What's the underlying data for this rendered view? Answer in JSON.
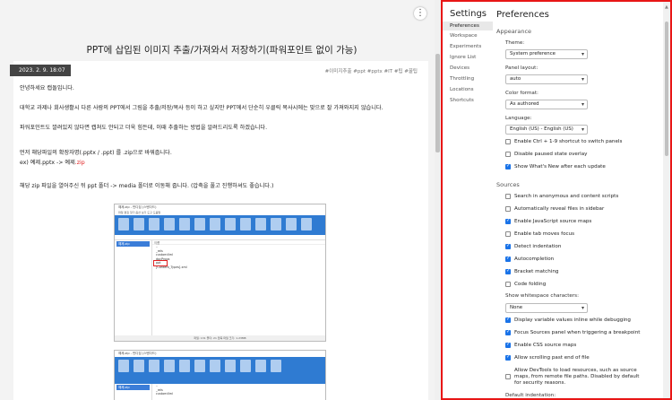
{
  "blog": {
    "menu_icon": "more-vertical-icon",
    "title": "PPT에 삽입된 이미지 추출/가져와서 저장하기(파워포인트 없이 가능)",
    "date": "2023. 2. 9. 18:07",
    "tags": "#이미지추출 #ppt #pptx #IT #팁 #꿀팁",
    "paragraphs": {
      "p1": "안녕하세요 캡돌입니다.",
      "p2": "대학교 과제나 회사생활시 다른 사람의 PPT에서 그림을 추출/저장/복사 등이 하고 싶지만 PPT에서 단순히 우클릭 복사시에는 맞으로 잘 가져와지지 않습니다.",
      "p3": "파워포인트도 깔려있지 않다면 캡쳐도 안되고 더욱 힘든데, 이때 추출하는 방법을 알려드리도록 하겠습니다.",
      "p4": "먼저 해당파일의 확장자명(.pptx / .ppt) 를 .zip으로 바꿔줍니다.",
      "p5_prefix": "ex) 예제.pptx -> 예제",
      "p5_red": ".zip",
      "p6": "해당 zip 파일을 열어주신 뒤 ppt 폴더 -> media 폴더로 이동해 줍니다. (압축을 풀고 진행하셔도 좋습니다.)"
    },
    "screenshot1": {
      "title": "예제.zip - 반디집 (스탠다드)",
      "menu": "파일  편집  찾기  옵션  보기  도구  도움말",
      "tree_item": "예제.zip",
      "header_name": "이름",
      "rows": [
        "..",
        "_rels",
        "customXml",
        "docProps",
        "ppt",
        "[Content_Types].xml"
      ],
      "status": "파일: 131  폴더: 21  압축 파일 크기: 1.23MB"
    },
    "screenshot2": {
      "title": "예제.zip - 반디집 (스탠다드)",
      "tree_item": "예제.zip",
      "rows": [
        "..",
        "_rels",
        "customXml"
      ]
    }
  },
  "devtools": {
    "nav_title": "Settings",
    "nav_items": [
      "Preferences",
      "Workspace",
      "Experiments",
      "Ignore List",
      "Devices",
      "Throttling",
      "Locations",
      "Shortcuts"
    ],
    "page_title": "Preferences",
    "appearance": {
      "heading": "Appearance",
      "theme_label": "Theme:",
      "theme_value": "System preference",
      "panel_layout_label": "Panel layout:",
      "panel_layout_value": "auto",
      "color_format_label": "Color format:",
      "color_format_value": "As authored",
      "language_label": "Language:",
      "language_value": "English (US) - English (US)",
      "checkboxes": [
        {
          "label": "Enable Ctrl + 1-9 shortcut to switch panels",
          "checked": false
        },
        {
          "label": "Disable paused state overlay",
          "checked": false
        },
        {
          "label": "Show What's New after each update",
          "checked": true
        }
      ]
    },
    "sources": {
      "heading": "Sources",
      "checkboxes": [
        {
          "label": "Search in anonymous and content scripts",
          "checked": false
        },
        {
          "label": "Automatically reveal files in sidebar",
          "checked": false
        },
        {
          "label": "Enable JavaScript source maps",
          "checked": true
        },
        {
          "label": "Enable tab moves focus",
          "checked": false
        },
        {
          "label": "Detect indentation",
          "checked": true
        },
        {
          "label": "Autocompletion",
          "checked": true
        },
        {
          "label": "Bracket matching",
          "checked": true
        },
        {
          "label": "Code folding",
          "checked": false
        }
      ],
      "whitespace_label": "Show whitespace characters:",
      "whitespace_value": "None",
      "checkboxes2": [
        {
          "label": "Display variable values inline while debugging",
          "checked": true
        },
        {
          "label": "Focus Sources panel when triggering a breakpoint",
          "checked": true
        },
        {
          "label": "Enable CSS source maps",
          "checked": true
        },
        {
          "label": "Allow scrolling past end of file",
          "checked": true
        }
      ],
      "remote_label_1": "Allow DevTools to load resources, such as source",
      "remote_label_2": "maps, from remote file paths. Disabled by default",
      "remote_label_3": "for security reasons.",
      "remote_checked": false,
      "default_indent_label": "Default indentation:"
    },
    "colors": {
      "border": "#e81616",
      "accent": "#1a73e8"
    }
  }
}
